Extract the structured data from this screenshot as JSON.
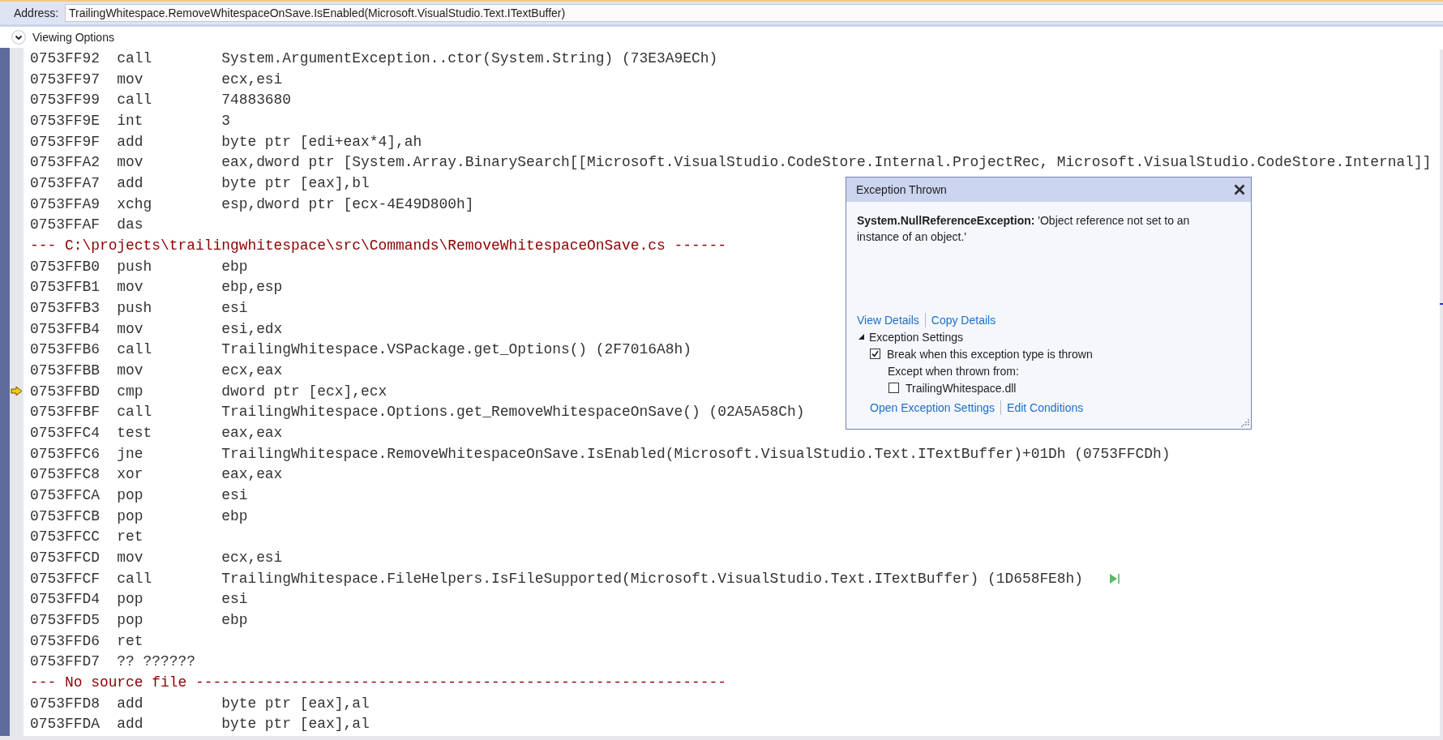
{
  "address_bar": {
    "label": "Address:",
    "value": "TrailingWhitespace.RemoveWhitespaceOnSave.IsEnabled(Microsoft.VisualStudio.Text.ITextBuffer)"
  },
  "viewing_options": {
    "label": "Viewing Options",
    "expanded": false
  },
  "disassembly": {
    "lines": [
      {
        "kind": "instruction",
        "address": "0753FF92",
        "mnemonic": "call",
        "operand": "System.ArgumentException..ctor(System.String) (73E3A9ECh)",
        "current": false,
        "run_to_cursor": false
      },
      {
        "kind": "instruction",
        "address": "0753FF97",
        "mnemonic": "mov",
        "operand": "ecx,esi",
        "current": false,
        "run_to_cursor": false
      },
      {
        "kind": "instruction",
        "address": "0753FF99",
        "mnemonic": "call",
        "operand": "74883680",
        "current": false,
        "run_to_cursor": false
      },
      {
        "kind": "instruction",
        "address": "0753FF9E",
        "mnemonic": "int",
        "operand": "3",
        "current": false,
        "run_to_cursor": false
      },
      {
        "kind": "instruction",
        "address": "0753FF9F",
        "mnemonic": "add",
        "operand": "byte ptr [edi+eax*4],ah",
        "current": false,
        "run_to_cursor": false
      },
      {
        "kind": "instruction",
        "address": "0753FFA2",
        "mnemonic": "mov",
        "operand": "eax,dword ptr [System.Array.BinarySearch[[Microsoft.VisualStudio.CodeStore.Internal.ProjectRec, Microsoft.VisualStudio.CodeStore.Internal]]",
        "current": false,
        "run_to_cursor": false
      },
      {
        "kind": "instruction",
        "address": "0753FFA7",
        "mnemonic": "add",
        "operand": "byte ptr [eax],bl",
        "current": false,
        "run_to_cursor": false
      },
      {
        "kind": "instruction",
        "address": "0753FFA9",
        "mnemonic": "xchg",
        "operand": "esp,dword ptr [ecx-4E49D800h]",
        "current": false,
        "run_to_cursor": false
      },
      {
        "kind": "instruction",
        "address": "0753FFAF",
        "mnemonic": "das",
        "current": false,
        "run_to_cursor": false
      },
      {
        "kind": "source",
        "text": "--- C:\\projects\\trailingwhitespace\\src\\Commands\\RemoveWhitespaceOnSave.cs ------",
        "current": false,
        "run_to_cursor": false
      },
      {
        "kind": "instruction",
        "address": "0753FFB0",
        "mnemonic": "push",
        "operand": "ebp",
        "current": false,
        "run_to_cursor": false
      },
      {
        "kind": "instruction",
        "address": "0753FFB1",
        "mnemonic": "mov",
        "operand": "ebp,esp",
        "current": false,
        "run_to_cursor": false
      },
      {
        "kind": "instruction",
        "address": "0753FFB3",
        "mnemonic": "push",
        "operand": "esi",
        "current": false,
        "run_to_cursor": false
      },
      {
        "kind": "instruction",
        "address": "0753FFB4",
        "mnemonic": "mov",
        "operand": "esi,edx",
        "current": false,
        "run_to_cursor": false
      },
      {
        "kind": "instruction",
        "address": "0753FFB6",
        "mnemonic": "call",
        "operand": "TrailingWhitespace.VSPackage.get_Options() (2F7016A8h)",
        "current": false,
        "run_to_cursor": false
      },
      {
        "kind": "instruction",
        "address": "0753FFBB",
        "mnemonic": "mov",
        "operand": "ecx,eax",
        "current": false,
        "run_to_cursor": false
      },
      {
        "kind": "instruction",
        "address": "0753FFBD",
        "mnemonic": "cmp",
        "operand": "dword ptr [ecx],ecx",
        "current": true,
        "run_to_cursor": false
      },
      {
        "kind": "instruction",
        "address": "0753FFBF",
        "mnemonic": "call",
        "operand": "TrailingWhitespace.Options.get_RemoveWhitespaceOnSave() (02A5A58Ch)",
        "current": false,
        "run_to_cursor": false
      },
      {
        "kind": "instruction",
        "address": "0753FFC4",
        "mnemonic": "test",
        "operand": "eax,eax",
        "current": false,
        "run_to_cursor": false
      },
      {
        "kind": "instruction",
        "address": "0753FFC6",
        "mnemonic": "jne",
        "operand": "TrailingWhitespace.RemoveWhitespaceOnSave.IsEnabled(Microsoft.VisualStudio.Text.ITextBuffer)+01Dh (0753FFCDh)",
        "current": false,
        "run_to_cursor": false
      },
      {
        "kind": "instruction",
        "address": "0753FFC8",
        "mnemonic": "xor",
        "operand": "eax,eax",
        "current": false,
        "run_to_cursor": false
      },
      {
        "kind": "instruction",
        "address": "0753FFCA",
        "mnemonic": "pop",
        "operand": "esi",
        "current": false,
        "run_to_cursor": false
      },
      {
        "kind": "instruction",
        "address": "0753FFCB",
        "mnemonic": "pop",
        "operand": "ebp",
        "current": false,
        "run_to_cursor": false
      },
      {
        "kind": "instruction",
        "address": "0753FFCC",
        "mnemonic": "ret",
        "current": false,
        "run_to_cursor": false
      },
      {
        "kind": "instruction",
        "address": "0753FFCD",
        "mnemonic": "mov",
        "operand": "ecx,esi",
        "current": false,
        "run_to_cursor": false
      },
      {
        "kind": "instruction",
        "address": "0753FFCF",
        "mnemonic": "call",
        "operand": "TrailingWhitespace.FileHelpers.IsFileSupported(Microsoft.VisualStudio.Text.ITextBuffer) (1D658FE8h)",
        "current": false,
        "run_to_cursor": true
      },
      {
        "kind": "instruction",
        "address": "0753FFD4",
        "mnemonic": "pop",
        "operand": "esi",
        "current": false,
        "run_to_cursor": false
      },
      {
        "kind": "instruction",
        "address": "0753FFD5",
        "mnemonic": "pop",
        "operand": "ebp",
        "current": false,
        "run_to_cursor": false
      },
      {
        "kind": "instruction",
        "address": "0753FFD6",
        "mnemonic": "ret",
        "current": false,
        "run_to_cursor": false
      },
      {
        "kind": "raw",
        "address": "0753FFD7",
        "code": "?? ??????",
        "current": false,
        "run_to_cursor": false
      },
      {
        "kind": "source",
        "text": "--- No source file -------------------------------------------------------------",
        "current": false,
        "run_to_cursor": false
      },
      {
        "kind": "instruction",
        "address": "0753FFD8",
        "mnemonic": "add",
        "operand": "byte ptr [eax],al",
        "current": false,
        "run_to_cursor": false
      },
      {
        "kind": "instruction",
        "address": "0753FFDA",
        "mnemonic": "add",
        "operand": "byte ptr [eax],al",
        "current": false,
        "run_to_cursor": false
      }
    ]
  },
  "exception_popup": {
    "title": "Exception Thrown",
    "message": "**System.NullReferenceException:** 'Object reference not set to an instance of an object.'",
    "links": [
      "View Details",
      "Copy Details"
    ],
    "settings": {
      "title": "Exception Settings",
      "expanded": true,
      "break_option": {
        "label": "Break when this exception type is thrown",
        "checked": true
      },
      "except_label": "Except when thrown from:",
      "modules": [
        {
          "label": "TrailingWhitespace.dll",
          "checked": false
        }
      ]
    },
    "footer_links": [
      "Open Exception Settings",
      "Edit Conditions"
    ]
  }
}
